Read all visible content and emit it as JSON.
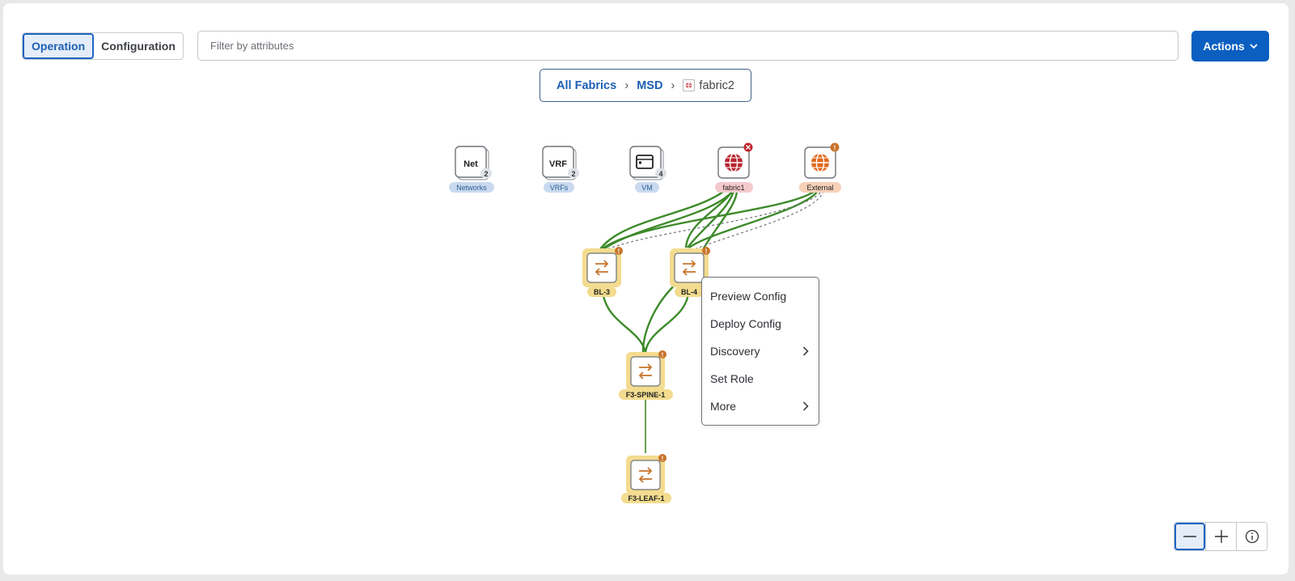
{
  "view_toggle": {
    "operation": "Operation",
    "configuration": "Configuration"
  },
  "filter": {
    "placeholder": "Filter by attributes"
  },
  "actions_label": "Actions",
  "breadcrumb": {
    "all_fabrics": "All Fabrics",
    "msd": "MSD",
    "current": "fabric2"
  },
  "top_nodes": [
    {
      "icon_text": "Net",
      "badge": "2",
      "label": "Networks"
    },
    {
      "icon_text": "VRF",
      "badge": "2",
      "label": "VRFs"
    },
    {
      "icon": "window-icon",
      "badge": "4",
      "label": "VM"
    },
    {
      "icon": "globe-icon",
      "status": "error",
      "label": "fabric1"
    },
    {
      "icon": "globe-icon",
      "status": "warning",
      "label": "External"
    }
  ],
  "switches": [
    {
      "label": "BL-3"
    },
    {
      "label": "BL-4"
    },
    {
      "label": "F3-SPINE-1"
    },
    {
      "label": "F3-LEAF-1"
    }
  ],
  "context_menu": [
    {
      "label": "Preview Config",
      "submenu": false
    },
    {
      "label": "Deploy Config",
      "submenu": false
    },
    {
      "label": "Discovery",
      "submenu": true
    },
    {
      "label": "Set Role",
      "submenu": false
    },
    {
      "label": "More",
      "submenu": true
    }
  ],
  "colors": {
    "link": "#3d8a2a",
    "accent": "#0b5fc1",
    "switch_bg": "#f3dc8f",
    "switch_icon": "#c7742a",
    "warning_badge": "#c7742a",
    "error_badge": "#c0262f",
    "fabric1_globe": "#b8242e",
    "external_globe": "#e06a1e"
  }
}
